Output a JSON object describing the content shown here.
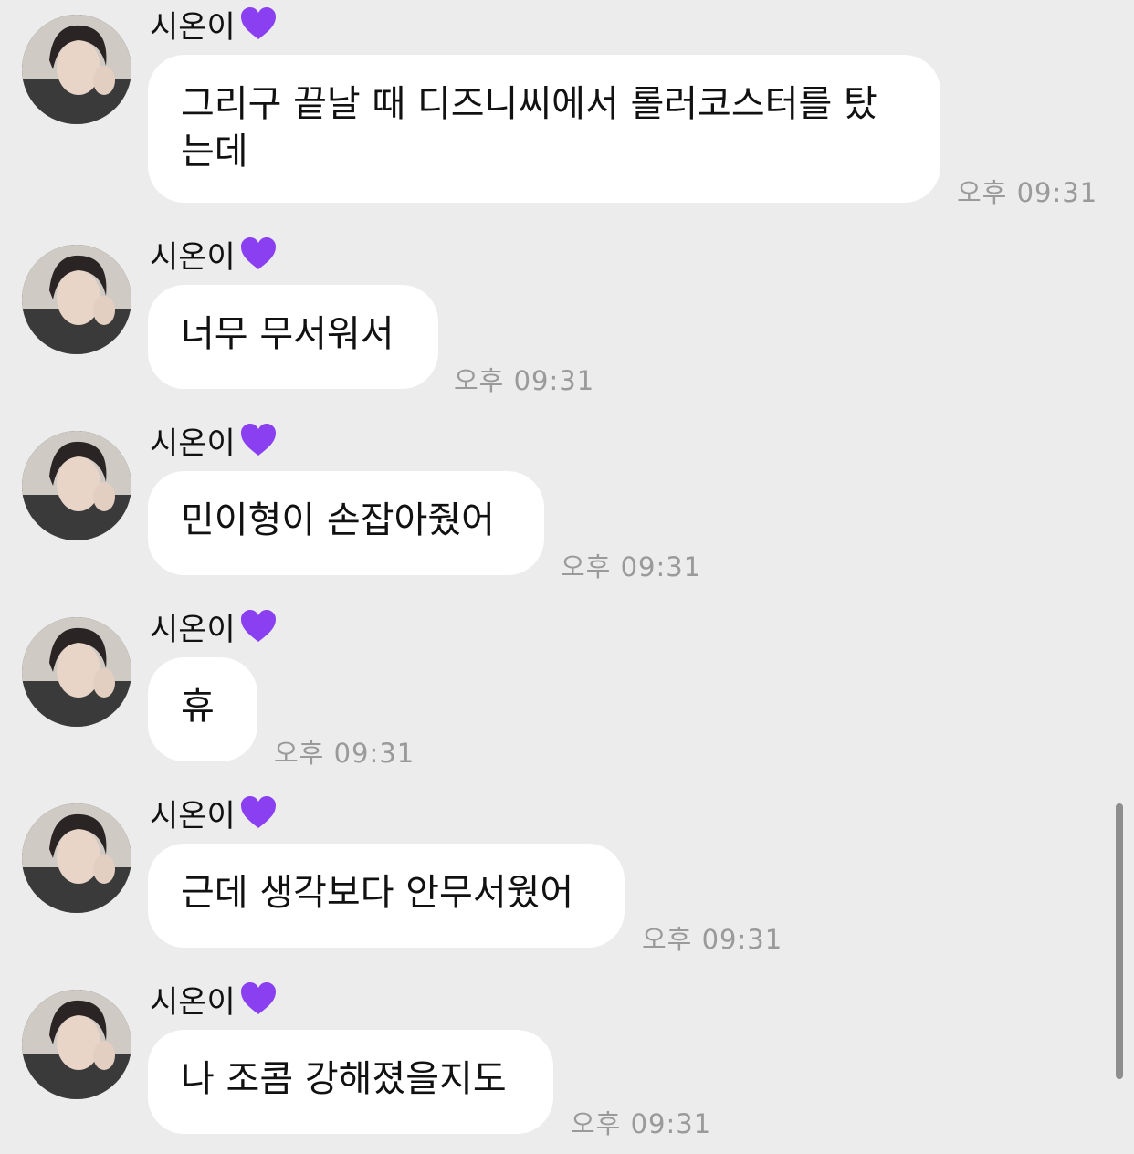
{
  "chat": {
    "messages": [
      {
        "sender": "시온이",
        "text": "그리구 끝날 때 디즈니씨에서 롤러코스터를 탔\n는데",
        "time": "오후 09:31"
      },
      {
        "sender": "시온이",
        "text": "너무 무서워서",
        "time": "오후 09:31"
      },
      {
        "sender": "시온이",
        "text": "민이형이 손잡아줬어",
        "time": "오후 09:31"
      },
      {
        "sender": "시온이",
        "text": "휴",
        "time": "오후 09:31"
      },
      {
        "sender": "시온이",
        "text": "근데 생각보다 안무서웠어",
        "time": "오후 09:31"
      },
      {
        "sender": "시온이",
        "text": "나 조콤 강해졌을지도",
        "time": "오후 09:31"
      }
    ]
  },
  "icons": {
    "sender_badge": "purple-heart-icon",
    "avatar": "profile-photo"
  },
  "colors": {
    "background": "#ececec",
    "bubble": "#ffffff",
    "heart": "#8a3ff0",
    "time_text": "#9a9a9a"
  }
}
